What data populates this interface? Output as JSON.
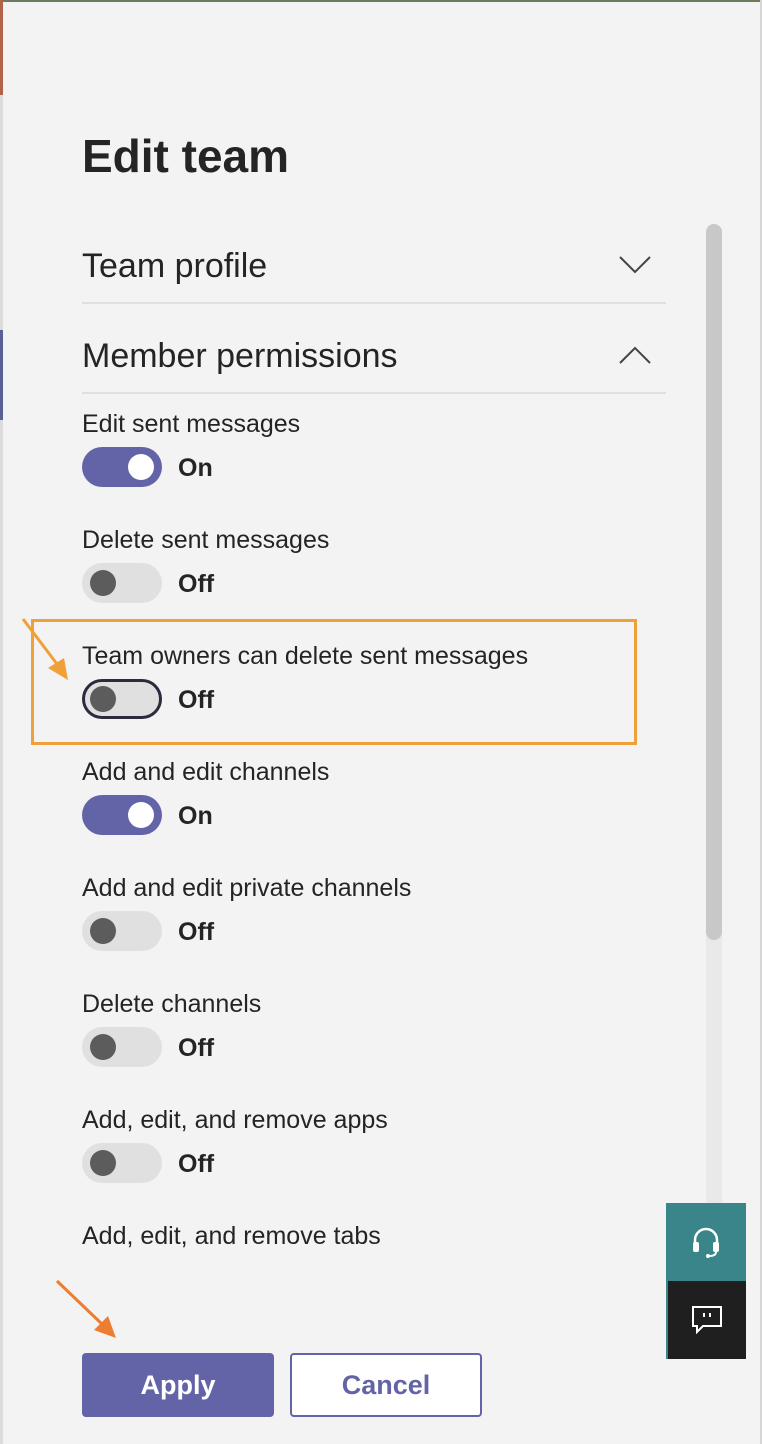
{
  "dialog": {
    "title": "Edit team"
  },
  "sections": {
    "profile": {
      "label": "Team profile",
      "icon": "chevron-down-icon",
      "expanded": false
    },
    "permissions": {
      "label": "Member permissions",
      "icon": "chevron-up-icon",
      "expanded": true
    }
  },
  "permissions": [
    {
      "label": "Edit sent messages",
      "state": "On",
      "on": true
    },
    {
      "label": "Delete sent messages",
      "state": "Off",
      "on": false
    },
    {
      "label": "Team owners can delete sent messages",
      "state": "Off",
      "on": false,
      "highlighted": true
    },
    {
      "label": "Add and edit channels",
      "state": "On",
      "on": true
    },
    {
      "label": "Add and edit private channels",
      "state": "Off",
      "on": false
    },
    {
      "label": "Delete channels",
      "state": "Off",
      "on": false
    },
    {
      "label": "Add, edit, and remove apps",
      "state": "Off",
      "on": false
    },
    {
      "label": "Add, edit, and remove tabs"
    }
  ],
  "buttons": {
    "apply": "Apply",
    "cancel": "Cancel"
  },
  "side_buttons": {
    "help_icon": "headset-icon",
    "feedback_icon": "feedback-icon"
  },
  "colors": {
    "accent": "#6264a7",
    "highlight": "#f0a038",
    "help_bg": "#3a8589"
  }
}
